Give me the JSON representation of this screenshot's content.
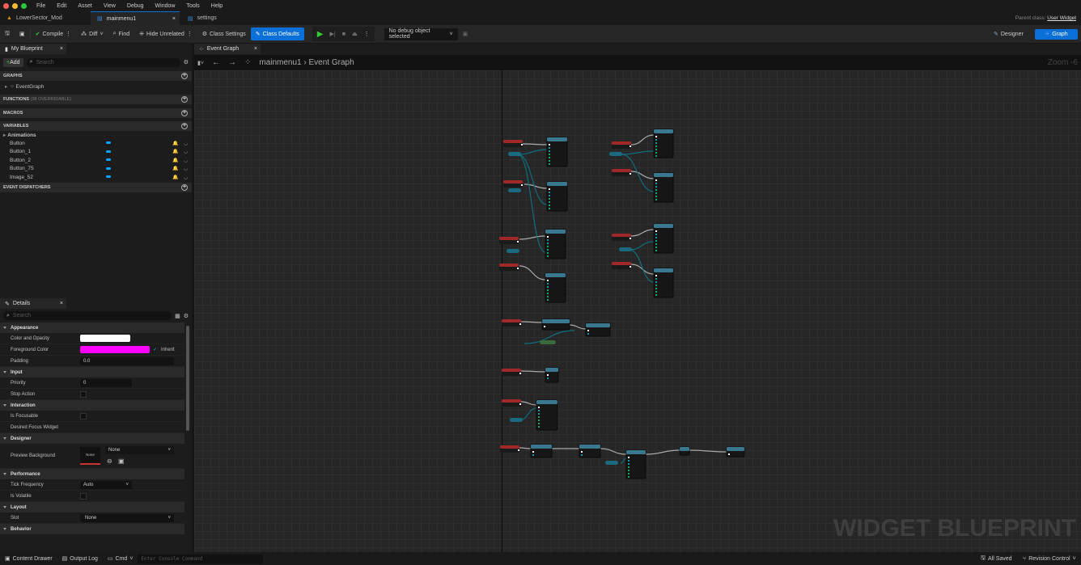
{
  "menubar": {
    "items": [
      "File",
      "Edit",
      "Asset",
      "View",
      "Debug",
      "Window",
      "Tools",
      "Help"
    ]
  },
  "tabs": [
    {
      "label": "LowerSector_Mod"
    },
    {
      "label": "mainmenu1"
    },
    {
      "label": "settings"
    }
  ],
  "parent_class": {
    "label": "Parent class:",
    "value": "User Widget"
  },
  "toolbar": {
    "compile": "Compile",
    "diff": "Diff",
    "find": "Find",
    "hide_unrelated": "Hide Unrelated",
    "class_settings": "Class Settings",
    "class_defaults": "Class Defaults",
    "debug_object": "No debug object selected",
    "designer": "Designer",
    "graph": "Graph",
    "accent": "#0a70d8"
  },
  "my_blueprint": {
    "tab": "My Blueprint",
    "add": "Add",
    "search_placeholder": "Search",
    "graphs": "GRAPHS",
    "event_graph": "EventGraph",
    "functions": "FUNCTIONS",
    "functions_note": "(38 OVERRIDABLE)",
    "macros": "MACROS",
    "variables": "VARIABLES",
    "animations": "Animations",
    "vars": [
      "Button",
      "Button_1",
      "Button_2",
      "Button_75",
      "Image_52"
    ],
    "event_dispatchers": "EVENT DISPATCHERS"
  },
  "details": {
    "tab": "Details",
    "search_placeholder": "Search",
    "appearance": "Appearance",
    "color_opacity": "Color and Opacity",
    "foreground_color": "Foreground Color",
    "foreground_hex": "#ff00ff",
    "inherit": "Inherit",
    "padding": "Padding",
    "padding_value": "0.0",
    "input": "Input",
    "priority": "Priority",
    "priority_value": "0",
    "stop_action": "Stop Action",
    "interaction": "Interaction",
    "is_focusable": "Is Focusable",
    "desired_focus": "Desired Focus Widget",
    "designer": "Designer",
    "preview_bg": "Preview Background",
    "preview_none": "None",
    "preview_select": "None",
    "performance": "Performance",
    "tick_frequency": "Tick Frequency",
    "tick_value": "Auto",
    "is_volatile": "Is Volatile",
    "layout": "Layout",
    "slot": "Slot",
    "slot_value": "None",
    "behavior": "Behavior"
  },
  "graph": {
    "tab": "Event Graph",
    "breadcrumb_root": "mainmenu1",
    "breadcrumb_leaf": "Event Graph",
    "zoom": "Zoom -6",
    "watermark": "WIDGET BLUEPRINT"
  },
  "statusbar": {
    "content_drawer": "Content Drawer",
    "output_log": "Output Log",
    "cmd": "Cmd",
    "console_placeholder": "Enter Console Command",
    "all_saved": "All Saved",
    "revision_control": "Revision Control"
  }
}
